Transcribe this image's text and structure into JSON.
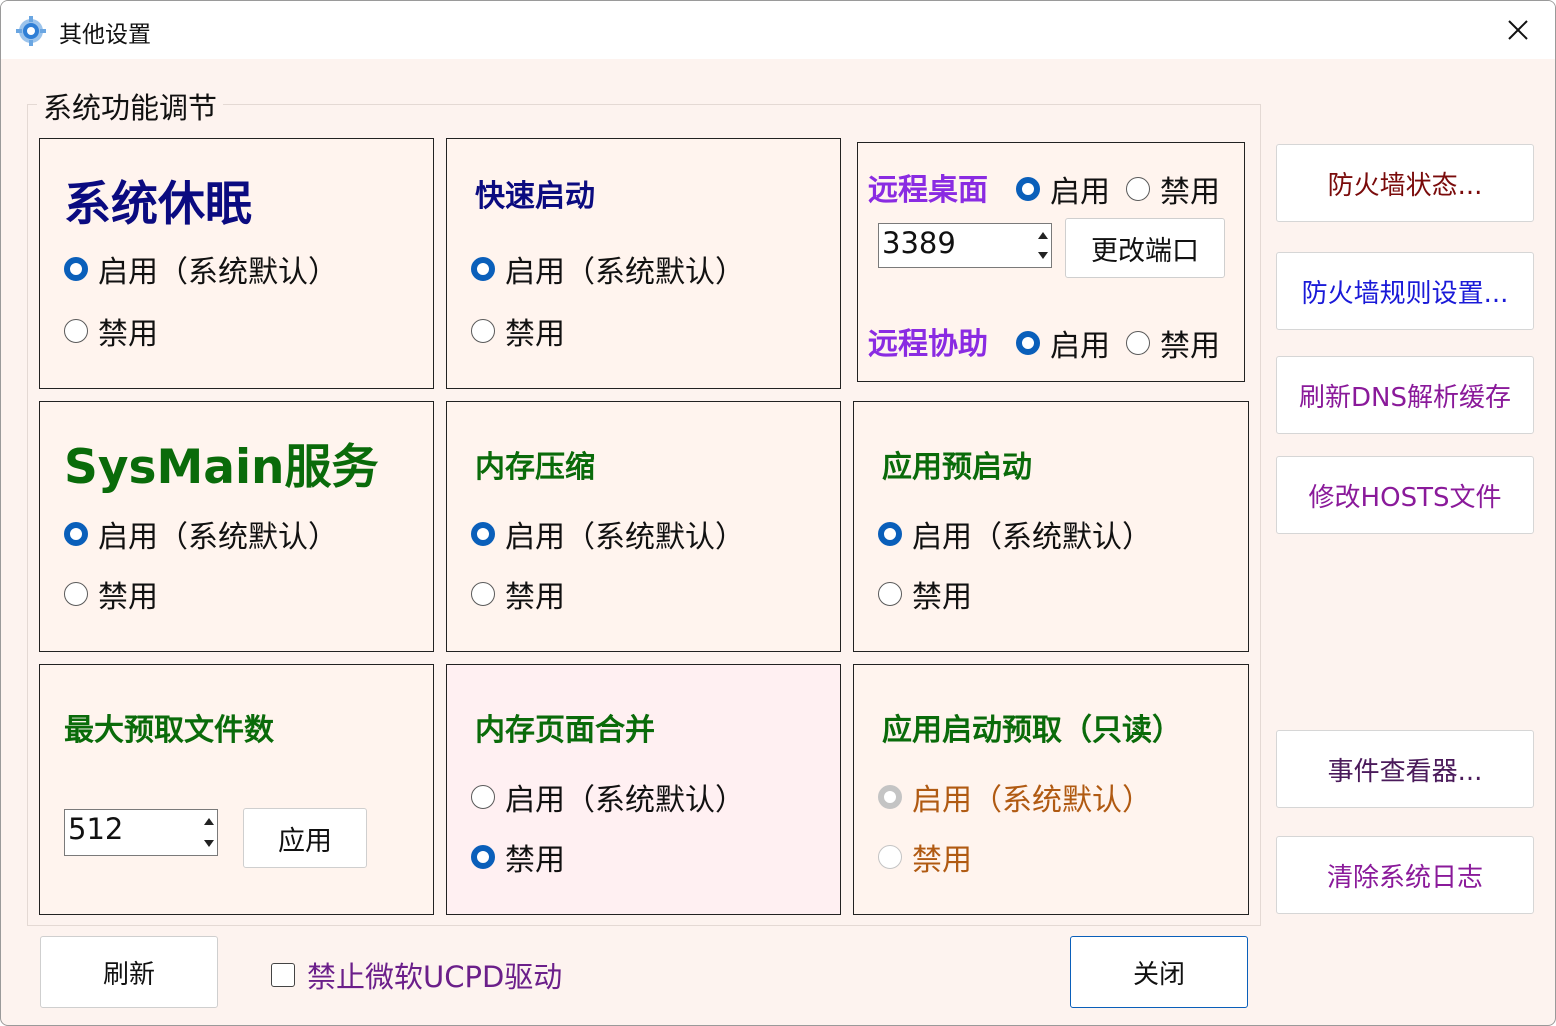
{
  "window": {
    "title": "其他设置",
    "icon": "gear-icon"
  },
  "group": {
    "legend": "系统功能调节"
  },
  "panels": {
    "hibernate": {
      "title": "系统休眠",
      "enable": "启用（系统默认）",
      "disable": "禁用",
      "selected": "enable"
    },
    "fastboot": {
      "title": "快速启动",
      "enable": "启用（系统默认）",
      "disable": "禁用",
      "selected": "enable"
    },
    "remote": {
      "desktop_title": "远程桌面",
      "desktop_enable": "启用",
      "desktop_disable": "禁用",
      "desktop_selected": "enable",
      "port": "3389",
      "change_port": "更改端口",
      "assist_title": "远程协助",
      "assist_enable": "启用",
      "assist_disable": "禁用",
      "assist_selected": "enable"
    },
    "sysmain": {
      "title": "SysMain服务",
      "enable": "启用（系统默认）",
      "disable": "禁用",
      "selected": "enable"
    },
    "memcompress": {
      "title": "内存压缩",
      "enable": "启用（系统默认）",
      "disable": "禁用",
      "selected": "enable"
    },
    "prelaunch": {
      "title": "应用预启动",
      "enable": "启用（系统默认）",
      "disable": "禁用",
      "selected": "enable"
    },
    "prefetch": {
      "title": "最大预取文件数",
      "value": "512",
      "apply": "应用"
    },
    "pagecombine": {
      "title": "内存页面合并",
      "enable": "启用（系统默认）",
      "disable": "禁用",
      "selected": "disable"
    },
    "launchprefetch": {
      "title": "应用启动预取（只读）",
      "enable": "启用（系统默认）",
      "disable": "禁用",
      "selected": "enable",
      "readonly": true
    }
  },
  "side_buttons": {
    "firewall_status": "防火墙状态...",
    "firewall_rules": "防火墙规则设置...",
    "flush_dns": "刷新DNS解析缓存",
    "edit_hosts": "修改HOSTS文件",
    "event_viewer": "事件查看器...",
    "clear_logs": "清除系统日志"
  },
  "footer": {
    "refresh": "刷新",
    "ucpd_checkbox": "禁止微软UCPD驱动",
    "ucpd_checked": false,
    "close": "关闭"
  },
  "colors": {
    "navy": "#0b0b80",
    "green": "#0a6b0a",
    "purple": "#8a2be2",
    "blue_link": "#1a1ad8",
    "maroon": "#7a0b0b",
    "violet": "#8a1a9a",
    "radio_on": "#0a5fba"
  }
}
